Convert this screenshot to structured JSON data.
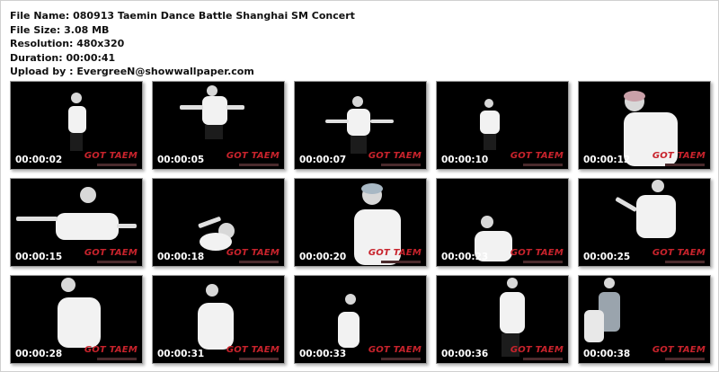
{
  "info": {
    "file_name": "File Name:  080913 Taemin Dance Battle Shanghai SM Concert",
    "file_size": "File Size: 3.08 MB",
    "resolution": "Resolution: 480x320",
    "duration": "Duration: 00:00:41",
    "upload_by": "Upload by : EvergreeN@showwallpaper.com"
  },
  "watermark": "GOT TAEM",
  "frames": [
    {
      "time": "00:00:02"
    },
    {
      "time": "00:00:05"
    },
    {
      "time": "00:00:07"
    },
    {
      "time": "00:00:10"
    },
    {
      "time": "00:00:12"
    },
    {
      "time": "00:00:15"
    },
    {
      "time": "00:00:18"
    },
    {
      "time": "00:00:20"
    },
    {
      "time": "00:00:23"
    },
    {
      "time": "00:00:25"
    },
    {
      "time": "00:00:28"
    },
    {
      "time": "00:00:31"
    },
    {
      "time": "00:00:33"
    },
    {
      "time": "00:00:36"
    },
    {
      "time": "00:00:38"
    }
  ],
  "colors": {
    "watermark": "#c8232c",
    "frame_bg": "#000000",
    "timestamp": "#ffffff"
  }
}
